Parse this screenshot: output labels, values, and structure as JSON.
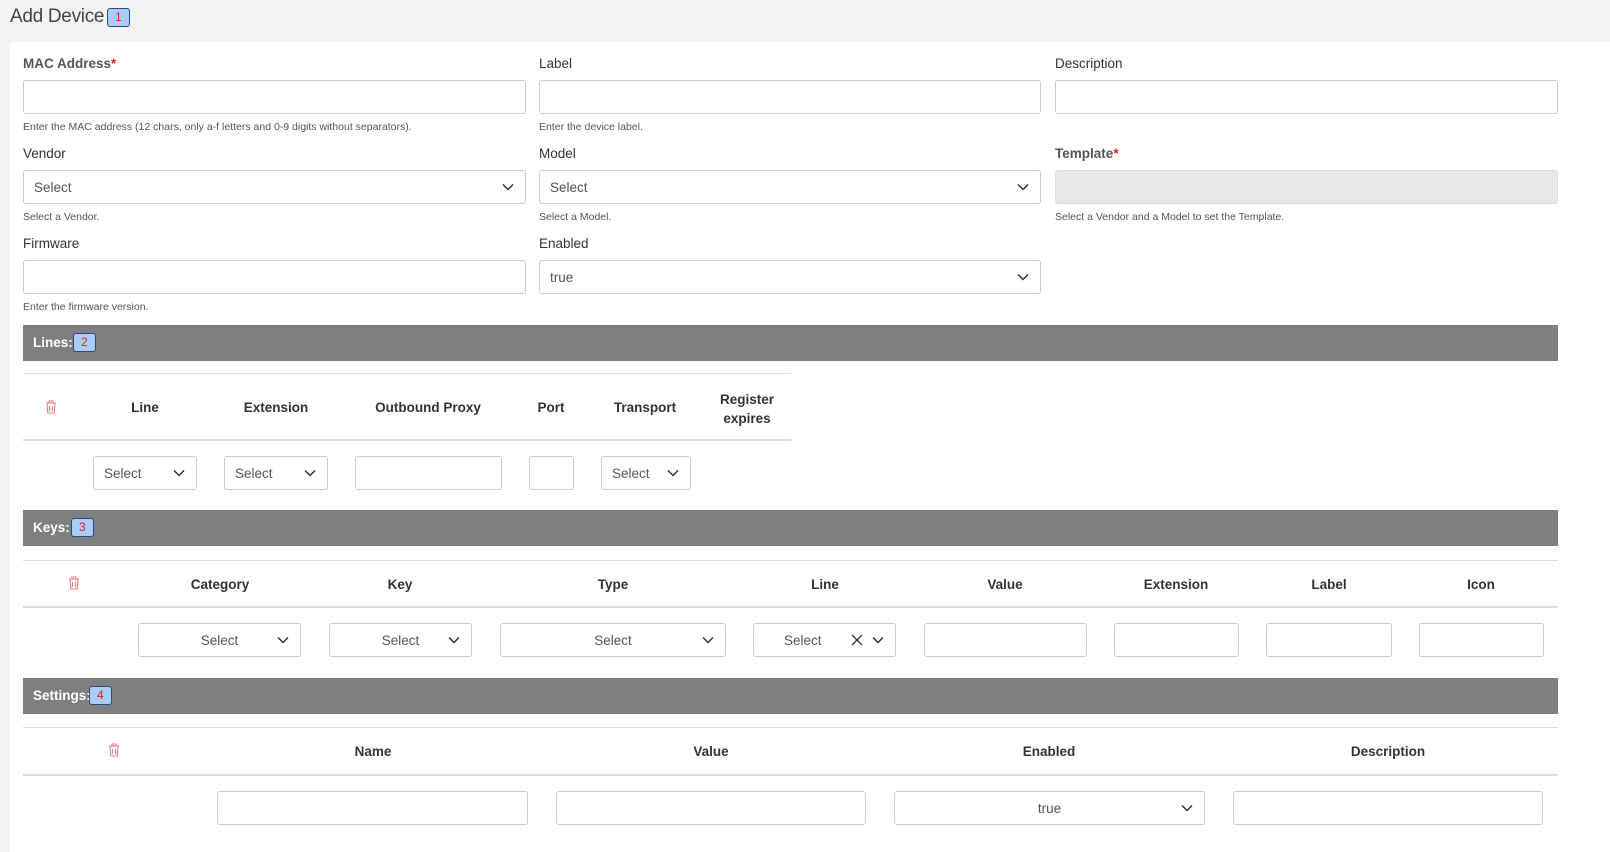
{
  "page": {
    "title": "Add Device",
    "badge": "1"
  },
  "form": {
    "mac": {
      "label": "MAC Address",
      "required_mark": "*",
      "value": "",
      "help": "Enter the MAC address (12 chars, only a-f letters and 0-9 digits without separators)."
    },
    "label": {
      "label": "Label",
      "value": "",
      "help": "Enter the device label."
    },
    "description": {
      "label": "Description",
      "value": ""
    },
    "vendor": {
      "label": "Vendor",
      "value": "Select",
      "help": "Select a Vendor."
    },
    "model": {
      "label": "Model",
      "value": "Select",
      "help": "Select a Model."
    },
    "template": {
      "label": "Template",
      "required_mark": "*",
      "value": "",
      "help": "Select a Vendor and a Model to set the Template."
    },
    "firmware": {
      "label": "Firmware",
      "value": "",
      "help": "Enter the firmware version."
    },
    "enabled": {
      "label": "Enabled",
      "value": "true"
    }
  },
  "lines": {
    "title": "Lines:",
    "badge": "2",
    "columns": [
      "Line",
      "Extension",
      "Outbound Proxy",
      "Port",
      "Transport",
      "Register expires"
    ],
    "row": {
      "line": "Select",
      "extension": "Select",
      "outbound_proxy": "",
      "port": "",
      "transport": "Select"
    }
  },
  "keys": {
    "title": "Keys:",
    "badge": "3",
    "columns": [
      "Category",
      "Key",
      "Type",
      "Line",
      "Value",
      "Extension",
      "Label",
      "Icon"
    ],
    "row": {
      "category": "Select",
      "key": "Select",
      "type": "Select",
      "line": "Select",
      "value": "",
      "extension": "",
      "label": "",
      "icon": ""
    }
  },
  "settings": {
    "title": "Settings:",
    "badge": "4",
    "columns": [
      "Name",
      "Value",
      "Enabled",
      "Description"
    ],
    "row": {
      "name": "",
      "value": "",
      "enabled": "true",
      "description": ""
    }
  },
  "colors": {
    "section_bar": "#7f7f7f",
    "badge_bg": "#a9cdf6",
    "badge_text": "#e02020",
    "required": "#e02020",
    "trash": "#f08080"
  },
  "icons": {
    "dropdown": "chevron-down-icon",
    "delete": "trash-icon",
    "clear": "close-icon"
  }
}
